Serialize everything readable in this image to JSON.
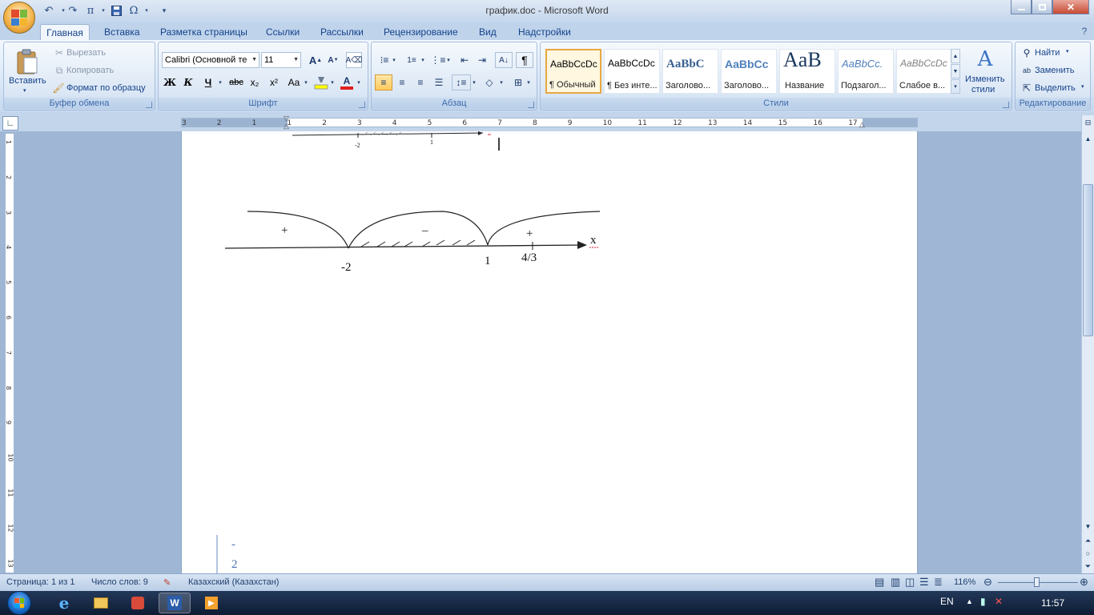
{
  "window": {
    "title": "график.doc - Microsoft Word"
  },
  "quick_access": {
    "icons": [
      "undo-icon",
      "redo-icon",
      "equation-icon",
      "save-icon",
      "symbol-icon"
    ],
    "equation_glyph": "π",
    "symbol_glyph": "Ω"
  },
  "tabs": [
    {
      "label": "Главная",
      "active": true
    },
    {
      "label": "Вставка"
    },
    {
      "label": "Разметка страницы"
    },
    {
      "label": "Ссылки"
    },
    {
      "label": "Рассылки"
    },
    {
      "label": "Рецензирование"
    },
    {
      "label": "Вид"
    },
    {
      "label": "Надстройки"
    }
  ],
  "clipboard": {
    "paste": "Вставить",
    "cut": "Вырезать",
    "copy": "Копировать",
    "format_painter": "Формат по образцу",
    "label": "Буфер обмена"
  },
  "font": {
    "name": "Calibri (Основной те",
    "size": "11",
    "label": "Шрифт",
    "bold": "Ж",
    "italic": "К",
    "underline": "Ч",
    "strike": "abc",
    "sub": "x₂",
    "sup": "x²",
    "case": "Aa",
    "grow": "A",
    "shrink": "A"
  },
  "paragraph": {
    "label": "Абзац",
    "pilcrow": "¶"
  },
  "styles": {
    "label": "Стили",
    "items": [
      {
        "sample": "AaBbCcDc",
        "name": "¶ Обычный",
        "selected": true
      },
      {
        "sample": "AaBbCcDc",
        "name": "¶ Без инте..."
      },
      {
        "sample": "AaBbC",
        "name": "Заголово..."
      },
      {
        "sample": "AaBbCc",
        "name": "Заголово..."
      },
      {
        "sample": "AaB",
        "name": "Название"
      },
      {
        "sample": "AaBbCc.",
        "name": "Подзагол..."
      },
      {
        "sample": "AaBbCcDc",
        "name": "Слабое в..."
      }
    ],
    "change": "Изменить",
    "change2": "стили"
  },
  "editing": {
    "label": "Редактирование",
    "find": "Найти",
    "replace": "Заменить",
    "select": "Выделить"
  },
  "ruler": {
    "h_ticks": [
      "3",
      "2",
      "1",
      "1",
      "2",
      "3",
      "4",
      "5",
      "6",
      "7",
      "8",
      "9",
      "10",
      "11",
      "12",
      "13",
      "14",
      "15",
      "16",
      "17"
    ],
    "v_ticks": [
      "1",
      "2",
      "3",
      "4",
      "5",
      "6",
      "7",
      "8",
      "9",
      "10",
      "11",
      "12",
      "13"
    ]
  },
  "document": {
    "top_axis_labels": {
      "minus2": "-2",
      "one": "1"
    },
    "graph": {
      "plus_left": "+",
      "minus": "–",
      "plus_right": "+",
      "x_label": "x",
      "label_m2": "-2",
      "label_1": "1",
      "label_43": "4/3"
    },
    "bottom_text": {
      "line1": "-",
      "line2": "2"
    }
  },
  "status": {
    "page": "Страница: 1 из 1",
    "words": "Число слов: 9",
    "language": "Казахский (Казахстан)",
    "zoom": "116%"
  },
  "taskbar": {
    "lang": "EN",
    "time": "11:57"
  },
  "colors": {
    "ribbon_text": "#15428b",
    "accent_orange": "#e8a840",
    "taskbar": "#17284a"
  }
}
